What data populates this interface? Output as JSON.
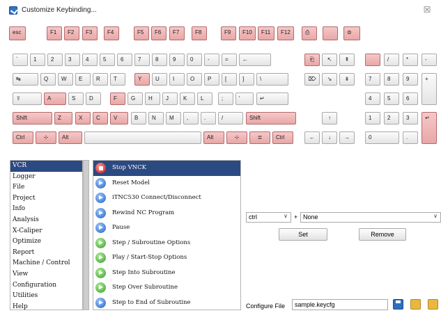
{
  "window": {
    "title": "Customize Keybinding...",
    "close_label": "☒"
  },
  "keyboard": {
    "row_fn": [
      {
        "label": "esc",
        "hl": true
      },
      {
        "label": "F1",
        "hl": true
      },
      {
        "label": "F2",
        "hl": true
      },
      {
        "label": "F3",
        "hl": true
      },
      {
        "label": "F4",
        "hl": true
      },
      {
        "label": "F5",
        "hl": true
      },
      {
        "label": "F6",
        "hl": true
      },
      {
        "label": "F7",
        "hl": true
      },
      {
        "label": "F8",
        "hl": true
      },
      {
        "label": "F9",
        "hl": true
      },
      {
        "label": "F10",
        "hl": true
      },
      {
        "label": "F11",
        "hl": true
      },
      {
        "label": "F12",
        "hl": true
      },
      {
        "label": "⎙",
        "hl": true
      },
      {
        "label": "",
        "hl": true
      },
      {
        "label": "⊜",
        "hl": true
      }
    ],
    "row_num": [
      "`",
      "1",
      "2",
      "3",
      "4",
      "5",
      "6",
      "7",
      "8",
      "9",
      "0",
      "-",
      "=",
      "←"
    ],
    "row_q": [
      "↹",
      "Q",
      "W",
      "E",
      "R",
      "T",
      "Y",
      "U",
      "I",
      "O",
      "P",
      "[",
      "]",
      "\\"
    ],
    "row_a": [
      "⇪",
      "A",
      "S",
      "D",
      "F",
      "G",
      "H",
      "J",
      "K",
      "L",
      ";",
      "'",
      "↵"
    ],
    "row_z": [
      "Shift",
      "Z",
      "X",
      "C",
      "V",
      "B",
      "N",
      "M",
      ",",
      ".",
      "/",
      "Shift"
    ],
    "row_ctrl": {
      "ctrl": "Ctrl",
      "win": "⊹",
      "alt": "Alt",
      "space": "",
      "alt_r": "Alt",
      "win_r": "⊹",
      "menu": "≣",
      "ctrl_r": "Ctrl"
    },
    "nav": [
      "⎗",
      "↖",
      "⇞",
      "⌦",
      "↘",
      "⇟",
      "↑",
      "←",
      "↓",
      "→"
    ],
    "numpad": [
      "",
      "/",
      "*",
      "-",
      "7",
      "8",
      "9",
      "+",
      "4",
      "5",
      "6",
      "1",
      "2",
      "3",
      "↵",
      "0",
      "."
    ]
  },
  "categories": {
    "selected": "VCR",
    "items": [
      "VCR",
      "Logger",
      "File",
      "Project",
      "Info",
      "Analysis",
      "X-Caliper",
      "Optimize",
      "Report",
      "Machine / Control",
      "View",
      "Configuration",
      "Utilities",
      "Help"
    ]
  },
  "actions": {
    "selected": "Stop VNCK",
    "items": [
      {
        "label": "Stop VNCK",
        "icon": "stop-icon"
      },
      {
        "label": "Reset Model",
        "icon": "eject-icon"
      },
      {
        "label": "iTNC530 Connect/Disconnect",
        "icon": "connect-icon"
      },
      {
        "label": "Rewind NC Program",
        "icon": "rewind-icon"
      },
      {
        "label": "Pause",
        "icon": "pause-icon"
      },
      {
        "label": "Step / Subroutine Options",
        "icon": "step-icon"
      },
      {
        "label": "Play / Start-Stop Options",
        "icon": "play-icon"
      },
      {
        "label": "Step Into Subroutine",
        "icon": "step-into-icon"
      },
      {
        "label": "Step Over Subroutine",
        "icon": "step-over-icon"
      },
      {
        "label": "Step to End of Subroutine",
        "icon": "step-end-icon"
      }
    ]
  },
  "binding": {
    "modifier_value": "ctrl",
    "modifier_arrow": "∨",
    "plus": "+",
    "key_value": "None",
    "key_arrow": "∨",
    "set_label": "Set",
    "remove_label": "Remove"
  },
  "config": {
    "label": "Configure File",
    "filename": "sample.keycfg"
  }
}
